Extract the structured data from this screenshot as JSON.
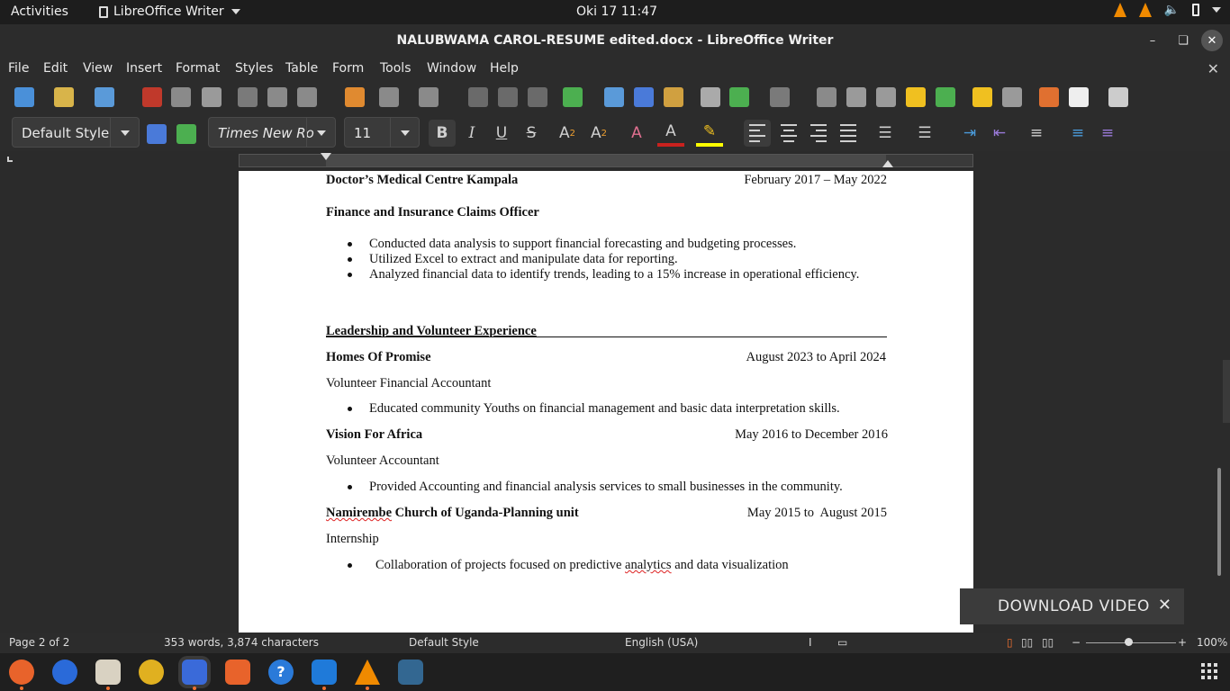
{
  "topbar": {
    "activities": "Activities",
    "app_name": "LibreOffice Writer",
    "clock": "Oki 17  11:47"
  },
  "window": {
    "title": "NALUBWAMA CAROL-RESUME edited.docx - LibreOffice Writer"
  },
  "menu": [
    "File",
    "Edit",
    "View",
    "Insert",
    "Format",
    "Styles",
    "Table",
    "Form",
    "Tools",
    "Window",
    "Help"
  ],
  "format_bar": {
    "paragraph_style": "Default Style",
    "font_name": "Times New Ro",
    "font_size": "11"
  },
  "document": {
    "employer1": "Doctor’s Medical Centre Kampala",
    "employer1_dates": "February 2017 – May 2022",
    "role1": "Finance and Insurance Claims Officer",
    "bullets1": [
      "Conducted data analysis to support financial forecasting and budgeting processes.",
      "Utilized Excel to extract and manipulate data for reporting.",
      "Analyzed financial data to identify trends, leading to a 15% increase in operational efficiency."
    ],
    "section_heading": "Leadership and Volunteer Experience",
    "org1": "Homes Of Promise",
    "org1_dates": "August 2023 to April 2024",
    "org1_role": "Volunteer Financial Accountant",
    "org1_bullet": "Educated community Youths on financial management and basic data interpretation skills.",
    "org2": "Vision For Africa",
    "org2_dates": "May 2016 to December 2016",
    "org2_role": "Volunteer Accountant",
    "org2_bullet": "Provided Accounting and financial analysis services to small businesses in the community.",
    "org3_word1": "Namirembe",
    "org3_rest": " Church of Uganda-Planning unit",
    "org3_dates": "May 2015 to  August 2015",
    "org3_role": "Internship",
    "org3_bullet_pre": "Collaboration of projects focused on predictive ",
    "org3_bullet_word": "analytics",
    "org3_bullet_post": " and data visualization"
  },
  "toast": {
    "label": "DOWNLOAD VIDEO"
  },
  "statusbar": {
    "page": "Page 2 of 2",
    "words": "353 words, 3,874 characters",
    "style": "Default Style",
    "language": "English (USA)",
    "zoom": "100%"
  },
  "colors": {
    "font_color": "#c9211e",
    "highlight": "#ffff00",
    "vlc_orange": "#f08a00"
  }
}
